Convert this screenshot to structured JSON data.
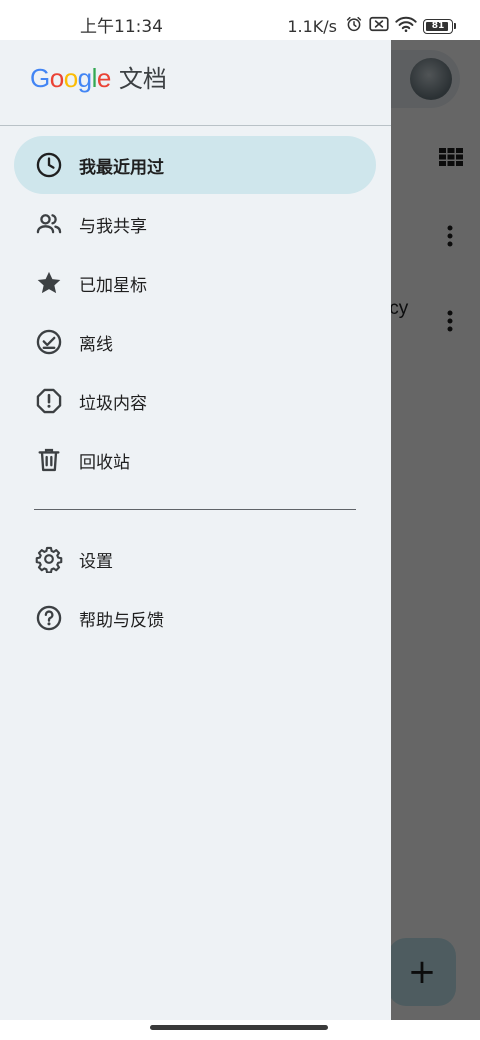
{
  "status_bar": {
    "time": "上午11:34",
    "net_speed": "1.1K/s",
    "battery": "81"
  },
  "background": {
    "partial_text": "icy",
    "fab_symbol": "+"
  },
  "drawer": {
    "logo_text": "Google",
    "product_name": "文档",
    "primary_items": [
      {
        "label": "我最近用过",
        "icon": "clock-icon",
        "active": true
      },
      {
        "label": "与我共享",
        "icon": "people-icon",
        "active": false
      },
      {
        "label": "已加星标",
        "icon": "star-icon",
        "active": false
      },
      {
        "label": "离线",
        "icon": "offline-check-icon",
        "active": false
      },
      {
        "label": "垃圾内容",
        "icon": "spam-icon",
        "active": false
      },
      {
        "label": "回收站",
        "icon": "trash-icon",
        "active": false
      }
    ],
    "secondary_items": [
      {
        "label": "设置",
        "icon": "gear-icon"
      },
      {
        "label": "帮助与反馈",
        "icon": "help-icon"
      }
    ]
  },
  "colors": {
    "drawer_bg": "#eef2f5",
    "active_item_bg": "#cfe6ec",
    "google_blue": "#4285F4",
    "google_red": "#EA4335",
    "google_yellow": "#FBBC05",
    "google_green": "#34A853"
  }
}
